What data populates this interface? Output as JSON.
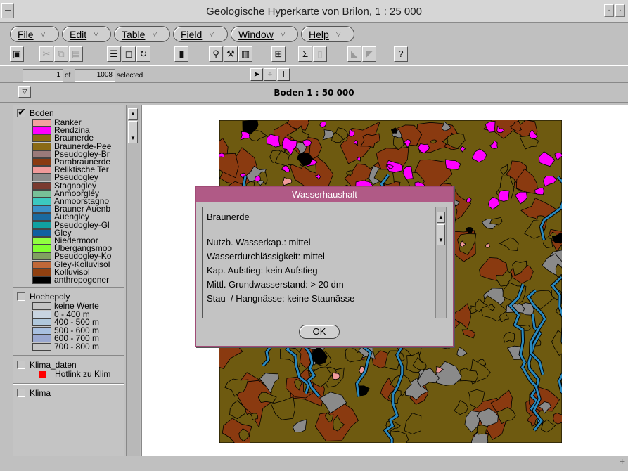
{
  "window": {
    "title": "Geologische Hyperkarte von Brilon, 1 : 25 000"
  },
  "menus": [
    {
      "label": "File"
    },
    {
      "label": "Edit"
    },
    {
      "label": "Table"
    },
    {
      "label": "Field"
    },
    {
      "label": "Window"
    },
    {
      "label": "Help"
    }
  ],
  "status": {
    "selected_count": "1",
    "of_label": "of",
    "total_count": "1008",
    "selected_label": "selected"
  },
  "view": {
    "title": "Boden 1 : 50 000"
  },
  "legend": {
    "boden": {
      "name": "Boden",
      "checked": true,
      "classes": [
        {
          "label": "Ranker",
          "color": "#f4a0a0"
        },
        {
          "label": "Rendzina",
          "color": "#ff00ff"
        },
        {
          "label": "Braunerde",
          "color": "#8b6b10"
        },
        {
          "label": "Braunerde-Pee",
          "color": "#8a6a16"
        },
        {
          "label": "Pseudogley-Br",
          "color": "#9a7a7a"
        },
        {
          "label": "Parabraunerde",
          "color": "#8a3a10"
        },
        {
          "label": "Reliktische Ter",
          "color": "#f09a9a"
        },
        {
          "label": "Pseudogley",
          "color": "#8a8a8a"
        },
        {
          "label": "Stagnogley",
          "color": "#7a3a30"
        },
        {
          "label": "Anmoorgley",
          "color": "#78c098"
        },
        {
          "label": "Anmoorstagno",
          "color": "#3cc8c0"
        },
        {
          "label": "Brauner Auenb",
          "color": "#3a90c8"
        },
        {
          "label": "Auengley",
          "color": "#1a6aa0"
        },
        {
          "label": "Pseudogley-Gl",
          "color": "#10a0a0"
        },
        {
          "label": "Gley",
          "color": "#1060a0"
        },
        {
          "label": "Niedermoor",
          "color": "#90ff40"
        },
        {
          "label": "Übergangsmoo",
          "color": "#80ff30"
        },
        {
          "label": "Pseudogley-Ko",
          "color": "#80a060"
        },
        {
          "label": "Gley-Kolluvisol",
          "color": "#c06838"
        },
        {
          "label": "Kolluvisol",
          "color": "#904010"
        },
        {
          "label": "anthropogener",
          "color": "#000000"
        }
      ]
    },
    "hoehepoly": {
      "name": "Hoehepoly",
      "checked": false,
      "classes": [
        {
          "label": "keine Werte",
          "color": "#c4c4c4"
        },
        {
          "label": "0 - 400 m",
          "color": "#c8d4e0"
        },
        {
          "label": "400 - 500 m",
          "color": "#b0c8dc"
        },
        {
          "label": "500 - 600 m",
          "color": "#a8c0e0"
        },
        {
          "label": "600 - 700 m",
          "color": "#9aa8d0"
        },
        {
          "label": "700 - 800 m",
          "color": "#c4c4c4"
        }
      ]
    },
    "klima_daten": {
      "name": "Klima_daten",
      "checked": false,
      "symbol_label": "Hotlink zu Klim",
      "symbol_color": "#ff0000"
    },
    "klima": {
      "name": "Klima",
      "checked": false
    }
  },
  "map_colors": {
    "base": "#6e5a10",
    "pink": "#ff00ff",
    "black": "#000000",
    "blue": "#2a8ac0",
    "brown": "#8a3a10",
    "grey": "#8a8a8a",
    "salmon": "#f09a9a"
  },
  "dialog": {
    "title": "Wasserhaushalt",
    "heading": "Braunerde",
    "lines": [
      "Nutzb. Wasserkap.: mittel",
      "Wasserdurchlässigkeit: mittel",
      "Kap. Aufstieg: kein Aufstieg",
      "Mittl. Grundwasserstand: > 20 dm",
      "Stau–/ Hangnässe: keine Staunässe"
    ],
    "ok_label": "OK"
  }
}
